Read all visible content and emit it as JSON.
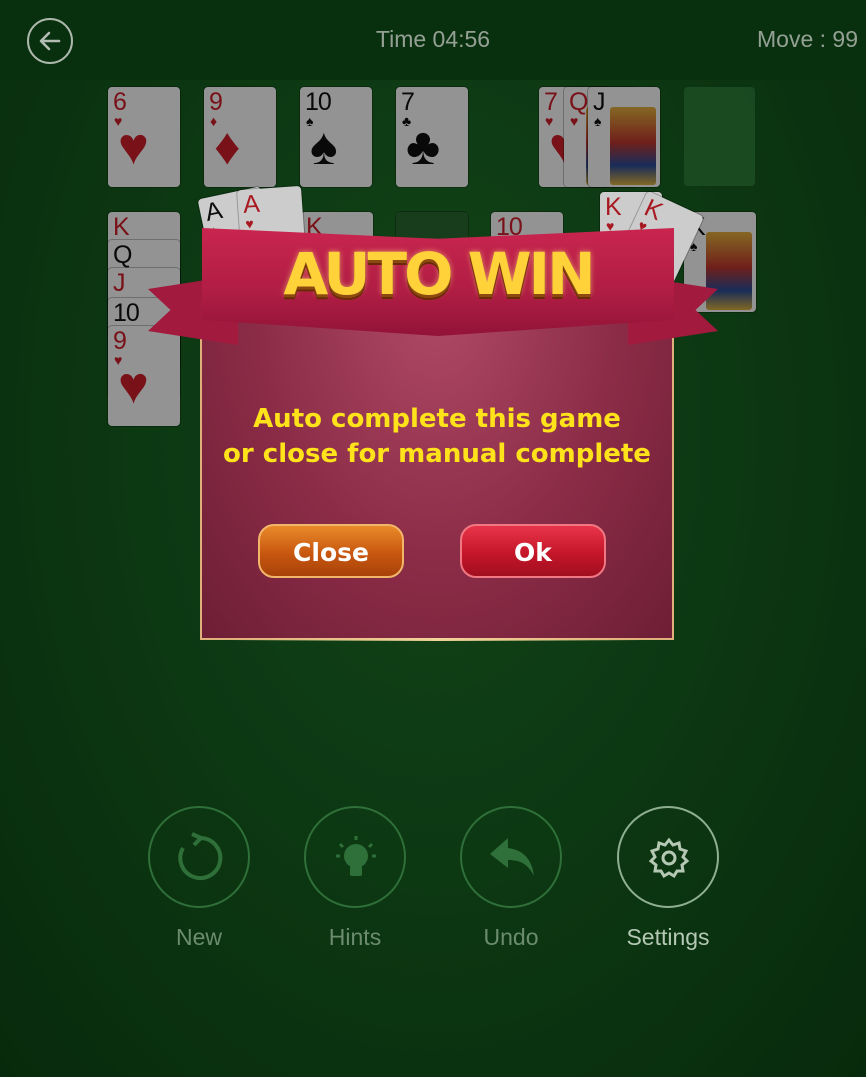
{
  "header": {
    "timer": "Time 04:56",
    "moves": "Move : 99",
    "back_icon": "arrow-left-icon"
  },
  "foundations": [
    {
      "rank": "6",
      "suit": "♥",
      "color": "red"
    },
    {
      "rank": "9",
      "suit": "♦",
      "color": "red"
    },
    {
      "rank": "10",
      "suit": "♠",
      "color": "black"
    },
    {
      "rank": "7",
      "suit": "♣",
      "color": "black"
    }
  ],
  "waste": [
    {
      "rank": "7",
      "suit": "♥"
    },
    {
      "rank": "Q",
      "suit": "♥"
    },
    {
      "rank": "J",
      "suit": "♠"
    }
  ],
  "tableau_left": [
    {
      "rank": "K",
      "suit": "♥"
    },
    {
      "rank": "Q",
      "suit": "♠"
    },
    {
      "rank": "J",
      "suit": "♥"
    },
    {
      "rank": "10",
      "suit": "♠"
    },
    {
      "rank": "9",
      "suit": "♥"
    }
  ],
  "tableau_peek": [
    {
      "rank": "A",
      "suit": "♠"
    },
    {
      "rank": "A",
      "suit": "♥"
    },
    {
      "rank": "K",
      "suit": "♥"
    },
    {
      "rank": "10",
      "suit": "♥"
    },
    {
      "rank": "K",
      "suit": "♥"
    },
    {
      "rank": "K",
      "suit": "♥"
    },
    {
      "rank": "K",
      "suit": "♠"
    }
  ],
  "dialog": {
    "title": "AUTO WIN",
    "message_line1": "Auto complete this game",
    "message_line2": "or close for manual complete",
    "close_label": "Close",
    "ok_label": "Ok"
  },
  "toolbar": {
    "new_label": "New",
    "hints_label": "Hints",
    "undo_label": "Undo",
    "settings_label": "Settings"
  },
  "colors": {
    "felt": "#0f4416",
    "topbar": "#0b3c12",
    "ribbon": "#b01d44",
    "title_gold": "#ffd23a",
    "message_yellow": "#ffe31a",
    "close_orange": "#c8570f",
    "ok_red": "#c51629"
  }
}
